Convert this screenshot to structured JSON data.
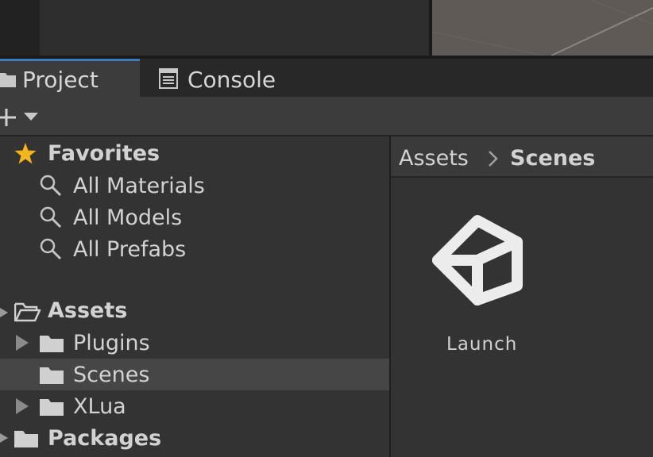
{
  "tabs": [
    {
      "label": "Project",
      "active": true,
      "icon": "folder-icon"
    },
    {
      "label": "Console",
      "active": false,
      "icon": "console-icon"
    }
  ],
  "toolbar": {
    "add_icon": "plus-icon",
    "dropdown_icon": "caret-down-icon"
  },
  "tree": {
    "favorites": {
      "label": "Favorites",
      "icon": "star-icon",
      "items": [
        {
          "label": "All Materials",
          "icon": "search-icon"
        },
        {
          "label": "All Models",
          "icon": "search-icon"
        },
        {
          "label": "All Prefabs",
          "icon": "search-icon"
        }
      ]
    },
    "assets": {
      "label": "Assets",
      "icon": "folder-open-icon",
      "items": [
        {
          "label": "Plugins",
          "icon": "folder-icon",
          "expandable": true
        },
        {
          "label": "Scenes",
          "icon": "folder-icon",
          "expandable": false,
          "selected": true
        },
        {
          "label": "XLua",
          "icon": "folder-icon",
          "expandable": true
        }
      ]
    },
    "packages": {
      "label": "Packages",
      "icon": "folder-icon"
    }
  },
  "breadcrumb": {
    "root": "Assets",
    "separator": ">",
    "current": "Scenes"
  },
  "files": [
    {
      "label": "Launch",
      "icon": "unity-scene-icon"
    }
  ],
  "colors": {
    "background": "#282828",
    "panel": "#333333",
    "selected_row": "#464646",
    "active_tab_highlight": "#3a79bb",
    "star": "#f2b51b",
    "text": "#d4d4d4"
  }
}
